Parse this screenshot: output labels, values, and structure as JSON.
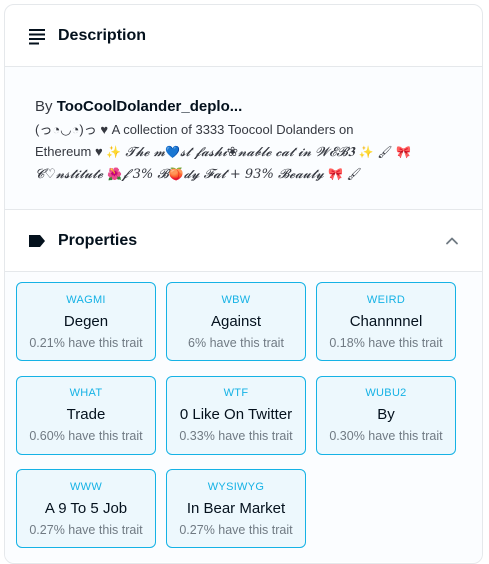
{
  "description": {
    "header_label": "Description",
    "by_prefix": "By",
    "creator": "TooCoolDolander_deplo...",
    "text_line1_part1": "(っ◔◡◔)っ ♥ A collection of 3333 Toocool Dolanders on",
    "text_line2_part1": "Ethereum ♥ ",
    "sparkle1": "✨",
    "script_text": " 𝓣𝓱𝓮 𝓶",
    "heart": "💙",
    "script_text2": "𝓼𝓽 𝓯𝓪𝓼𝓱𝓲",
    "flower1": "❀",
    "script_text3": "𝓷𝓪𝓫𝓵𝓮 𝓬𝓪𝓽 𝓲𝓷 𝓦𝓔𝓑𝟑 ",
    "sparkle2": "✨",
    "brush": "🖌",
    "ribbon1": "🎀",
    "line3_script1": "𝓒♡𝓷𝓼𝓽𝓲𝓽𝓾𝓽𝓮 ",
    "flower2": "🌺",
    "line3_script2": "𝓯 3% 𝓑",
    "peach": "🍑",
    "line3_script3": "𝓭𝔂 𝓕𝓪𝓽 + 93% 𝓑𝓮𝓪𝓾𝓽𝔂 ",
    "ribbon2": "🎀",
    "brush2": "🖌"
  },
  "properties": {
    "header_label": "Properties",
    "traits": [
      {
        "type": "WAGMI",
        "value": "Degen",
        "rarity": "0.21% have this trait"
      },
      {
        "type": "WBW",
        "value": "Against",
        "rarity": "6% have this trait"
      },
      {
        "type": "WEIRD",
        "value": "Channnnel",
        "rarity": "0.18% have this trait"
      },
      {
        "type": "WHAT",
        "value": "Trade",
        "rarity": "0.60% have this trait"
      },
      {
        "type": "WTF",
        "value": "0 Like On Twitter",
        "rarity": "0.33% have this trait"
      },
      {
        "type": "WUBU2",
        "value": "By",
        "rarity": "0.30% have this trait"
      },
      {
        "type": "WWW",
        "value": "A 9 To 5 Job",
        "rarity": "0.27% have this trait"
      },
      {
        "type": "WYSIWYG",
        "value": "In Bear Market",
        "rarity": "0.27% have this trait"
      }
    ]
  },
  "icons": {
    "description": "lines-icon",
    "properties": "label-tag-icon",
    "collapse": "chevron-up-icon"
  },
  "colors": {
    "accent": "#15b2e5",
    "text_primary": "#04111d",
    "text_secondary": "#707a83",
    "border": "#e5e8eb"
  }
}
